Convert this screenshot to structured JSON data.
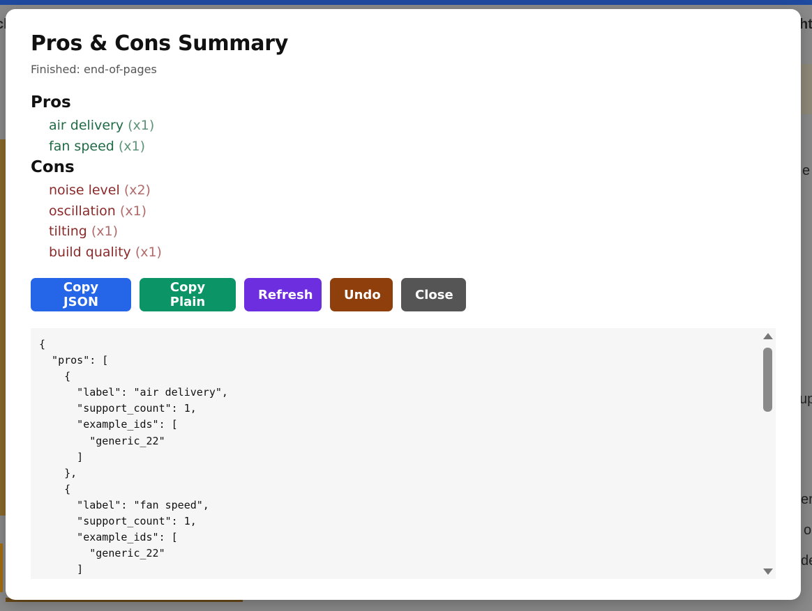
{
  "modal": {
    "title": "Pros & Cons Summary",
    "subtitle": "Finished: end-of-pages"
  },
  "pros": {
    "heading": "Pros",
    "items": [
      {
        "label": "air delivery",
        "count": "(x1)"
      },
      {
        "label": "fan speed",
        "count": "(x1)"
      }
    ]
  },
  "cons": {
    "heading": "Cons",
    "items": [
      {
        "label": "noise level",
        "count": "(x2)"
      },
      {
        "label": "oscillation",
        "count": "(x1)"
      },
      {
        "label": "tilting",
        "count": "(x1)"
      },
      {
        "label": "build quality",
        "count": "(x1)"
      }
    ]
  },
  "buttons": {
    "copy_json": "Copy JSON",
    "copy_plain": "Copy Plain",
    "refresh": "Refresh",
    "undo": "Undo",
    "close": "Close"
  },
  "json_preview": "{\n  \"pros\": [\n    {\n      \"label\": \"air delivery\",\n      \"support_count\": 1,\n      \"example_ids\": [\n        \"generic_22\"\n      ]\n    },\n    {\n      \"label\": \"fan speed\",\n      \"support_count\": 1,\n      \"example_ids\": [\n        \"generic_22\"\n      ]",
  "background": {
    "fragments": [
      "ch",
      "ht",
      "e",
      "up",
      "er",
      "o",
      "de"
    ]
  },
  "colors": {
    "pro_label": "#1f6b45",
    "con_label": "#8b2a2a",
    "copy_json": "#2565e8",
    "copy_plain": "#0b9466",
    "refresh": "#6d2ee0",
    "undo": "#8f3f0c",
    "close": "#555555"
  }
}
